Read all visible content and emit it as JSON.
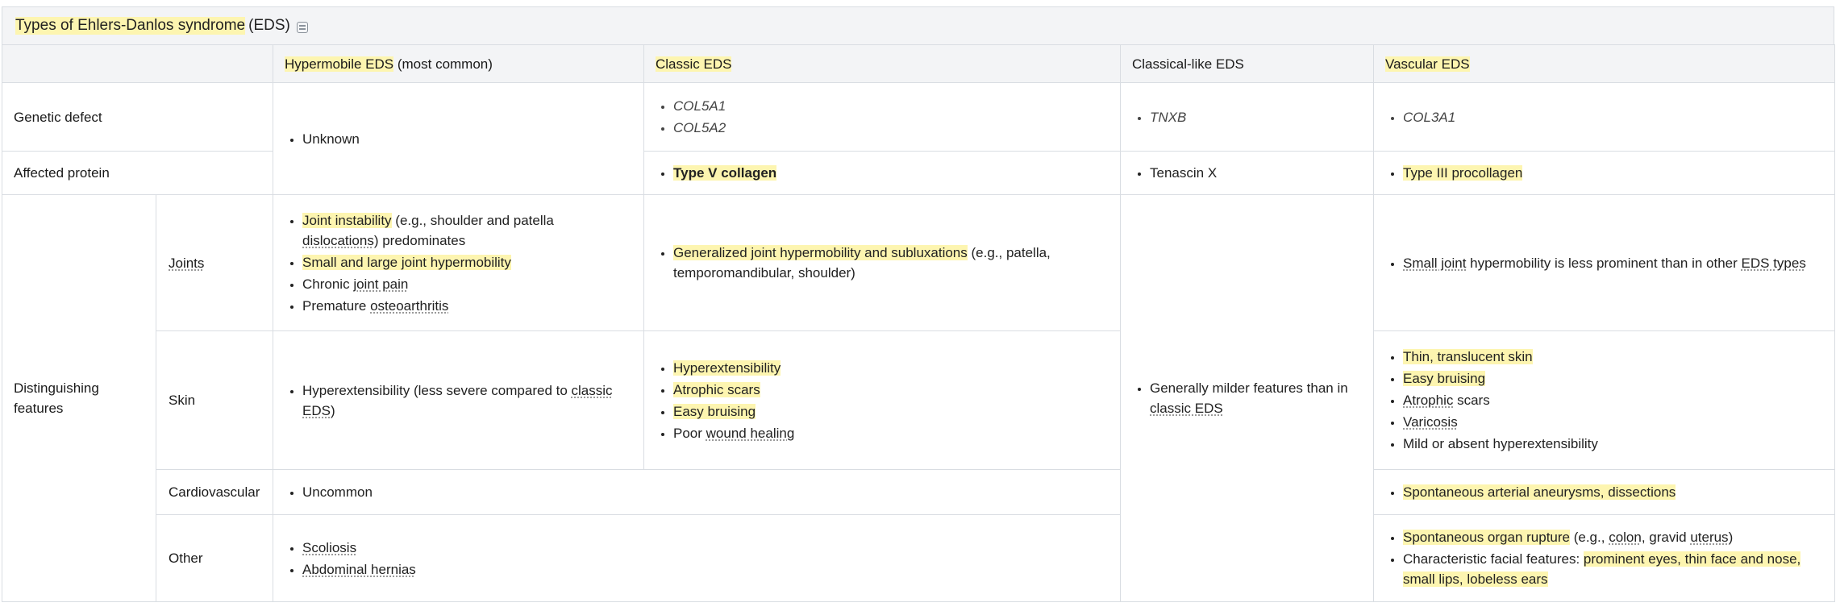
{
  "title": {
    "highlighted": "Types of Ehlers-Danlos syndrome",
    "rest": "(EDS)",
    "icon": "note-icon"
  },
  "headers": {
    "c0": "",
    "c1_hl": "Hypermobile EDS",
    "c1_rest": "(most common)",
    "c2": "Classic EDS",
    "c3": "Classical-like EDS",
    "c4": "Vascular EDS"
  },
  "rows": {
    "genetic_defect": "Genetic defect",
    "affected_protein": "Affected protein",
    "distinguishing": "Distinguishing features",
    "joints": "Joints",
    "skin": "Skin",
    "cardiovascular": "Cardiovascular",
    "other": "Other"
  },
  "cells": {
    "hyp_gen": "Unknown",
    "classic_gen_1": "COL5A1",
    "classic_gen_2": "COL5A2",
    "clike_gen": "TNXB",
    "vasc_gen": "COL3A1",
    "classic_prot": "Type V collagen",
    "clike_prot": "Tenascin X",
    "vasc_prot": "Type III procollagen",
    "hyp_joint_1a": "Joint instability",
    "hyp_joint_1b": " (e.g., shoulder and patella ",
    "hyp_joint_1c": "dislocations",
    "hyp_joint_1d": ") predominates",
    "hyp_joint_2": "Small and large joint hypermobility",
    "hyp_joint_3a": "Chronic ",
    "hyp_joint_3b": "joint pain",
    "hyp_joint_4a": "Premature ",
    "hyp_joint_4b": "osteoarthritis",
    "classic_joint_a": "Generalized joint hypermobility and subluxations",
    "classic_joint_b": " (e.g., patella, temporomandibular, shoulder)",
    "clike_features_a": "Generally milder features than in ",
    "clike_features_b": "classic EDS",
    "vasc_joint_a": "Small joint",
    "vasc_joint_b": " hypermobility is less prominent than in other ",
    "vasc_joint_c": "EDS types",
    "hyp_skin_a": "Hyperextensibility (less severe compared to ",
    "hyp_skin_b": "classic EDS",
    "hyp_skin_c": ")",
    "classic_skin_1": "Hyperextensibility",
    "classic_skin_2": "Atrophic scars",
    "classic_skin_3": "Easy bruising",
    "classic_skin_4a": "Poor ",
    "classic_skin_4b": "wound healing",
    "vasc_skin_1": "Thin, translucent skin",
    "vasc_skin_2": "Easy bruising",
    "vasc_skin_3a": "Atrophic",
    "vasc_skin_3b": " scars",
    "vasc_skin_4": "Varicosis",
    "vasc_skin_5": "Mild or absent hyperextensibility",
    "cardio_common": "Uncommon",
    "vasc_cardio": "Spontaneous arterial aneurysms, dissections",
    "other_1": "Scoliosis",
    "other_2": "Abdominal hernias",
    "vasc_other_1a": "Spontaneous organ rupture",
    "vasc_other_1b": " (e.g., ",
    "vasc_other_1c": "colon",
    "vasc_other_1d": ", gravid ",
    "vasc_other_1e": "uterus",
    "vasc_other_1f": ")",
    "vasc_other_2a": "Characteristic facial features: ",
    "vasc_other_2b": "prominent eyes, thin face and nose, small lips, lobeless ears"
  }
}
